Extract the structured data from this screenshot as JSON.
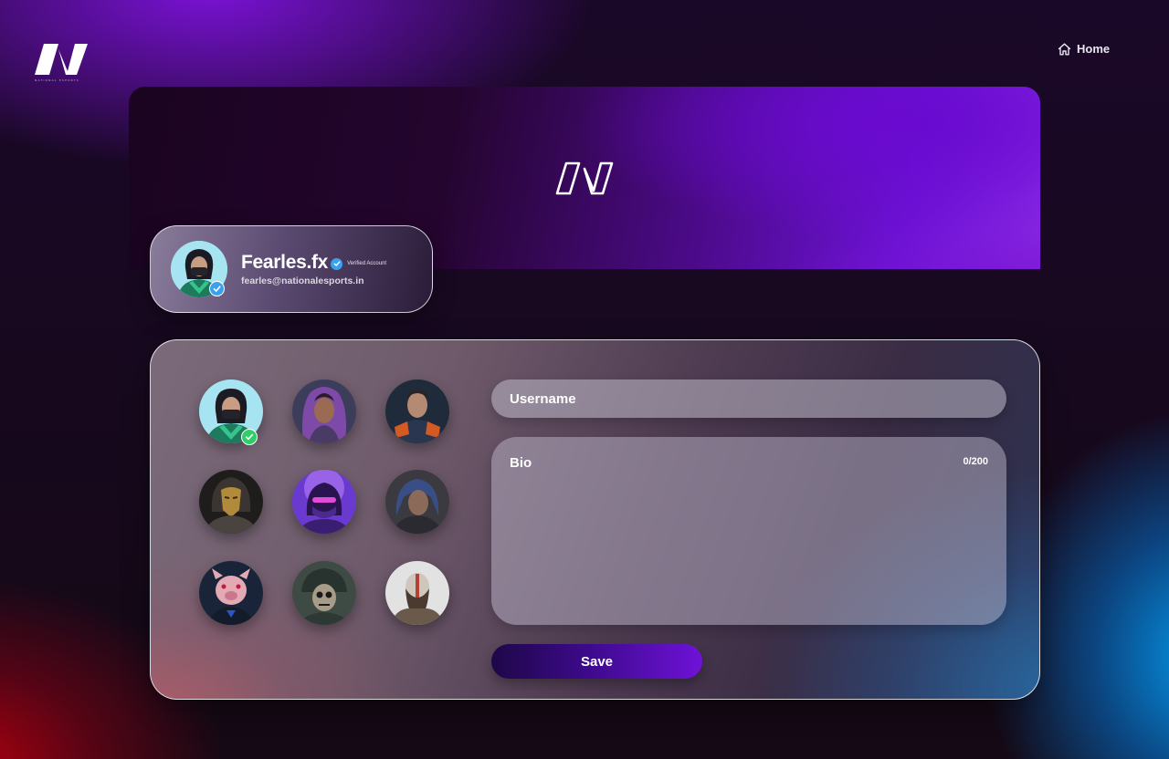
{
  "brand": {
    "logo_subtext": "NATIONAL ESPORTS",
    "logo_icon": "nationalesports-logo"
  },
  "nav": {
    "home_label": "Home",
    "home_icon": "home-icon"
  },
  "profile": {
    "name": "Fearles.fx",
    "verified_label": "Verified Account",
    "email": "fearles@nationalesports.in",
    "avatar_icon": "avatar-masked-agent"
  },
  "form": {
    "username_placeholder": "Username",
    "username_value": "",
    "bio_placeholder": "Bio",
    "bio_value": "",
    "bio_counter": "0/200",
    "save_label": "Save"
  },
  "avatars": [
    {
      "name": "masked-agent",
      "selected": true
    },
    {
      "name": "purple-hair-heroine",
      "selected": false
    },
    {
      "name": "cyber-soldier",
      "selected": false
    },
    {
      "name": "gold-mask-warrior",
      "selected": false
    },
    {
      "name": "neon-masked-ninja",
      "selected": false
    },
    {
      "name": "blue-hair-fighter",
      "selected": false
    },
    {
      "name": "pig-mask-hacker",
      "selected": false
    },
    {
      "name": "skull-helmet-soldier",
      "selected": false
    },
    {
      "name": "bearded-god-warrior",
      "selected": false
    }
  ],
  "colors": {
    "accent_purple": "#6e12d8",
    "verified_blue": "#3aa0f0",
    "selected_green": "#2fce6a"
  }
}
